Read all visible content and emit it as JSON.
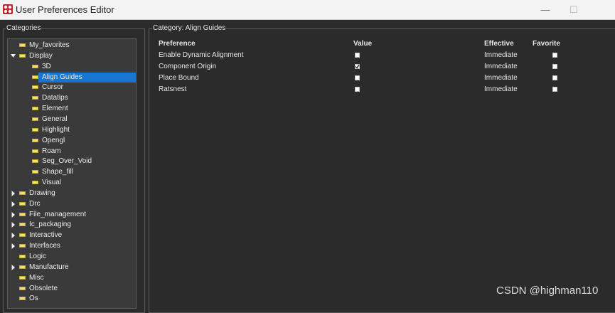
{
  "window": {
    "title": "User Preferences Editor",
    "minimize_glyph": "—",
    "maximize_glyph": "☐",
    "app_icon": "cadence-app-icon"
  },
  "categories": {
    "legend": "Categories",
    "items": [
      {
        "label": "My_favorites",
        "expand": "none"
      },
      {
        "label": "Display",
        "expand": "expanded"
      },
      {
        "label": "3D",
        "expand": "none"
      },
      {
        "label": "Align Guides",
        "expand": "none",
        "selected": true
      },
      {
        "label": "Cursor",
        "expand": "none"
      },
      {
        "label": "Datatips",
        "expand": "none"
      },
      {
        "label": "Element",
        "expand": "none"
      },
      {
        "label": "General",
        "expand": "none"
      },
      {
        "label": "Highlight",
        "expand": "none"
      },
      {
        "label": "Opengl",
        "expand": "none"
      },
      {
        "label": "Roam",
        "expand": "none"
      },
      {
        "label": "Seg_Over_Void",
        "expand": "none"
      },
      {
        "label": "Shape_fill",
        "expand": "none"
      },
      {
        "label": "Visual",
        "expand": "none"
      },
      {
        "label": "Drawing",
        "expand": "collapsed"
      },
      {
        "label": "Drc",
        "expand": "collapsed"
      },
      {
        "label": "File_management",
        "expand": "collapsed"
      },
      {
        "label": "Ic_packaging",
        "expand": "collapsed"
      },
      {
        "label": "Interactive",
        "expand": "collapsed"
      },
      {
        "label": "Interfaces",
        "expand": "collapsed"
      },
      {
        "label": "Logic",
        "expand": "none"
      },
      {
        "label": "Manufacture",
        "expand": "collapsed"
      },
      {
        "label": "Misc",
        "expand": "none"
      },
      {
        "label": "Obsolete",
        "expand": "none"
      },
      {
        "label": "Os",
        "expand": "none"
      }
    ]
  },
  "main": {
    "legend": "Category:  Align Guides",
    "columns": {
      "preference": "Preference",
      "value": "Value",
      "effective": "Effective",
      "favorite": "Favorite"
    },
    "rows": [
      {
        "preference": "Enable Dynamic Alignment",
        "value": false,
        "effective": "Immediate",
        "favorite": false
      },
      {
        "preference": "Component Origin",
        "value": true,
        "effective": "Immediate",
        "favorite": false
      },
      {
        "preference": "Place Bound",
        "value": false,
        "effective": "Immediate",
        "favorite": false
      },
      {
        "preference": "Ratsnest",
        "value": false,
        "effective": "Immediate",
        "favorite": false
      }
    ]
  },
  "watermark": "CSDN @highman110",
  "colors": {
    "background": "#2b2b2b",
    "tree_background": "#3a3a3a",
    "selection": "#1875d1",
    "folder": "#f2e36b"
  }
}
